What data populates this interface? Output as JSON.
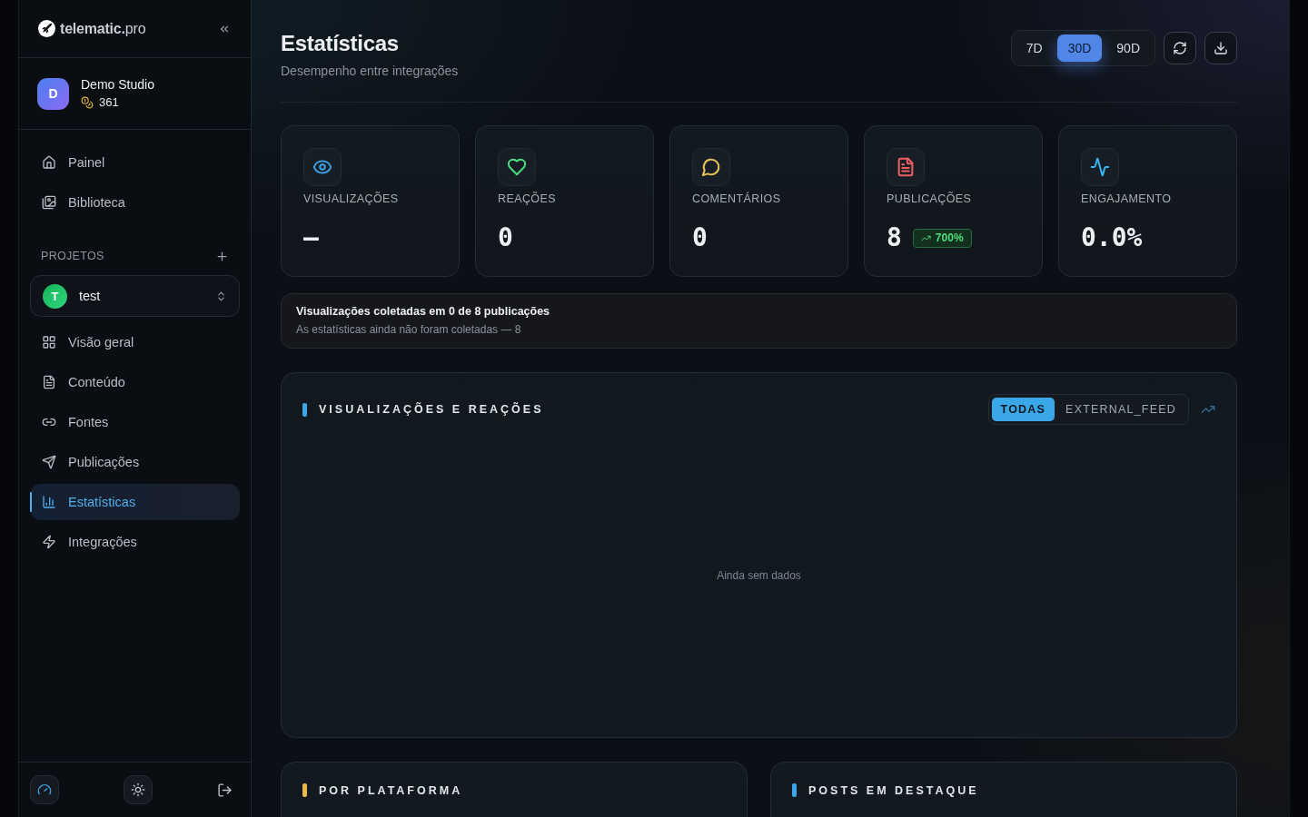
{
  "sidebar": {
    "brand": "**telematic.**pro",
    "account": {
      "initial": "D",
      "name": "Demo Studio",
      "credits": "361"
    },
    "main_nav": [
      {
        "label": "Painel",
        "selected": false
      },
      {
        "label": "Biblioteca",
        "selected": false
      }
    ],
    "projects_heading": "PROJETOS",
    "project": {
      "initial": "T",
      "name": "test"
    },
    "project_nav": [
      {
        "label": "Visão geral",
        "selected": false
      },
      {
        "label": "Conteúdo",
        "selected": false
      },
      {
        "label": "Fontes",
        "selected": false
      },
      {
        "label": "Publicações",
        "selected": false
      },
      {
        "label": "Estatísticas",
        "selected": true
      },
      {
        "label": "Integrações",
        "selected": false
      }
    ]
  },
  "header": {
    "title": "Estatísticas",
    "subtitle": "Desempenho entre integrações",
    "periods": [
      {
        "label": "7D",
        "selected": false
      },
      {
        "label": "30D",
        "selected": true
      },
      {
        "label": "90D",
        "selected": false
      }
    ]
  },
  "stats": [
    {
      "label": "VISUALIZAÇÕES",
      "value": "—"
    },
    {
      "label": "REAÇÕES",
      "value": "0"
    },
    {
      "label": "COMENTÁRIOS",
      "value": "0"
    },
    {
      "label": "PUBLICAÇÕES",
      "value": "8",
      "badge": "700%"
    },
    {
      "label": "ENGAJAMENTO",
      "value": "0.0%"
    }
  ],
  "notice": {
    "title": "Visualizações coletadas em 0 de 8 publicações",
    "text": "As estatísticas ainda não foram coletadas — 8"
  },
  "chart_panel": {
    "title": "VISUALIZAÇÕES E REAÇÕES",
    "filters": [
      {
        "label": "TODAS",
        "selected": true
      },
      {
        "label": "EXTERNAL_FEED",
        "selected": false
      }
    ],
    "empty_text": "Ainda sem dados"
  },
  "panels": [
    {
      "title": "POR PLATAFORMA",
      "color": "#e8b84a"
    },
    {
      "title": "POSTS EM DESTAQUE",
      "color": "#3ba6e8"
    }
  ]
}
